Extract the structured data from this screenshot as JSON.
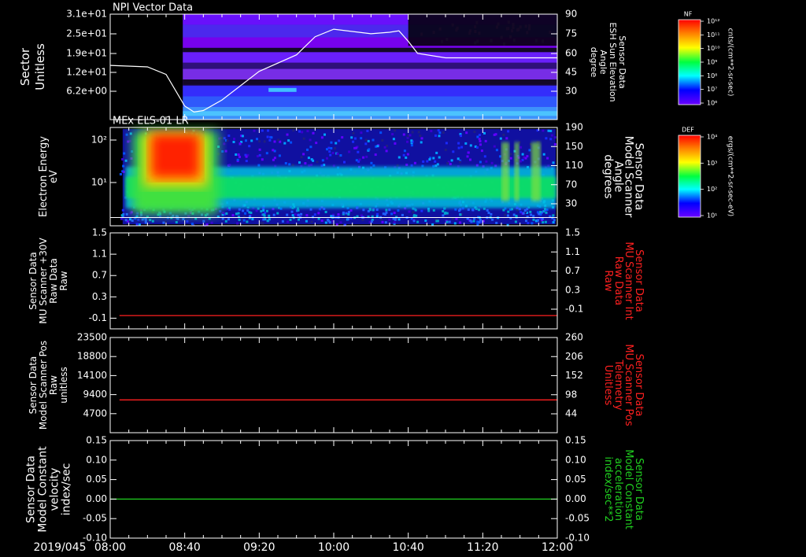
{
  "figure": {
    "date_label": "2019/045",
    "time_ticks": [
      "08:00",
      "08:40",
      "09:20",
      "10:00",
      "10:40",
      "11:20",
      "12:00"
    ]
  },
  "chart_data": [
    {
      "type": "heatmap",
      "title": "NPI Vector Data",
      "ylabel_left": [
        "Sector",
        "Unitless"
      ],
      "yticks_left": [
        "3.1e+01",
        "2.5e+01",
        "1.9e+01",
        "1.2e+01",
        "6.2e+00"
      ],
      "ylabel_right": [
        "Sensor Data",
        "ESH Sun Elevation",
        "Angle",
        "degree"
      ],
      "yticks_right": [
        "90",
        "75",
        "60",
        "45",
        "30"
      ],
      "colorbar": {
        "label": "NF",
        "unit": "cnts/(cm**2-sr-sec)",
        "ticks": [
          "10¹²",
          "10¹¹",
          "10¹⁰",
          "10⁹",
          "10⁸",
          "10⁷",
          "10⁶"
        ]
      },
      "data_start": "08:39",
      "line": {
        "name": "ESH Sun Elevation Angle",
        "x": [
          "08:00",
          "08:20",
          "08:30",
          "08:40",
          "08:45",
          "08:50",
          "09:00",
          "09:20",
          "09:40",
          "09:50",
          "10:00",
          "10:20",
          "10:30",
          "10:35",
          "10:40",
          "10:45",
          "11:00",
          "11:30",
          "12:00"
        ],
        "y": [
          56,
          55,
          50,
          29,
          25,
          26,
          33,
          52,
          63,
          75,
          80,
          77,
          78,
          79,
          72,
          64,
          61,
          61,
          61
        ]
      }
    },
    {
      "type": "heatmap",
      "title": "MEx ELS-01 LR",
      "ylabel_left": [
        "Electron Energy",
        "eV"
      ],
      "yticks_left": [
        "10²",
        "10¹"
      ],
      "ylabel_right": [
        "Sensor Data",
        "Model Scanner",
        "Angle",
        "degrees"
      ],
      "yticks_right": [
        "190",
        "150",
        "110",
        "70",
        "30"
      ],
      "colorbar": {
        "label": "DEF",
        "unit": "ergs/(cm**2-sr-sec-eV)",
        "ticks": [
          "10⁴",
          "10³",
          "10²",
          "10¹"
        ]
      },
      "data_start": "08:05",
      "reference_line_degrees": 16
    },
    {
      "type": "line",
      "ylabel_left": [
        "Sensor Data",
        "MU Scanner +30V",
        "Raw Data",
        "Raw"
      ],
      "yticks_left": [
        "1.5",
        "1.1",
        "0.7",
        "0.3",
        "-0.1"
      ],
      "ylabel_right": [
        "Sensor Data",
        "MU Scanner Int",
        "Raw Data",
        "Raw"
      ],
      "yticks_right": [
        "1.5",
        "1.1",
        "0.7",
        "0.3",
        "-0.1"
      ],
      "ylim": [
        -0.3,
        1.5
      ],
      "color": "#ff2020",
      "series": [
        {
          "x": [
            "08:05",
            "12:00"
          ],
          "values": [
            -0.05,
            -0.05
          ]
        }
      ]
    },
    {
      "type": "line",
      "ylabel_left": [
        "Sensor Data",
        "Model Scanner Pos",
        "Raw",
        "unitless"
      ],
      "yticks_left": [
        "23500",
        "18800",
        "14100",
        "9400",
        "4700"
      ],
      "ylabel_right": [
        "Sensor Data",
        "MU Scanner Pos",
        "Telemetry",
        "Unitless"
      ],
      "yticks_right": [
        "260",
        "206",
        "152",
        "98",
        "44"
      ],
      "ylim": [
        0,
        23500
      ],
      "color": "#ff2020",
      "series": [
        {
          "x": [
            "08:05",
            "12:00"
          ],
          "values": [
            8100,
            8100
          ]
        }
      ]
    },
    {
      "type": "line",
      "ylabel_left": [
        "Sensor Data",
        "Model Constant",
        "velocity",
        "index/sec"
      ],
      "yticks_left": [
        "0.15",
        "0.10",
        "0.05",
        "0.00",
        "-0.05",
        "-0.10"
      ],
      "ylabel_right": [
        "Sensor Data",
        "Model Constant",
        "acceleration",
        "index/sec**2"
      ],
      "yticks_right": [
        "0.15",
        "0.10",
        "0.05",
        "0.00",
        "-0.05",
        "-0.10"
      ],
      "ylim": [
        -0.1,
        0.15
      ],
      "color": "#20d020",
      "series": [
        {
          "x": [
            "08:00",
            "12:00"
          ],
          "values": [
            0.0,
            0.0
          ]
        }
      ]
    }
  ],
  "colors": {
    "axis": "#ffffff",
    "red_label": "#ff2020",
    "green_label": "#20d020"
  }
}
